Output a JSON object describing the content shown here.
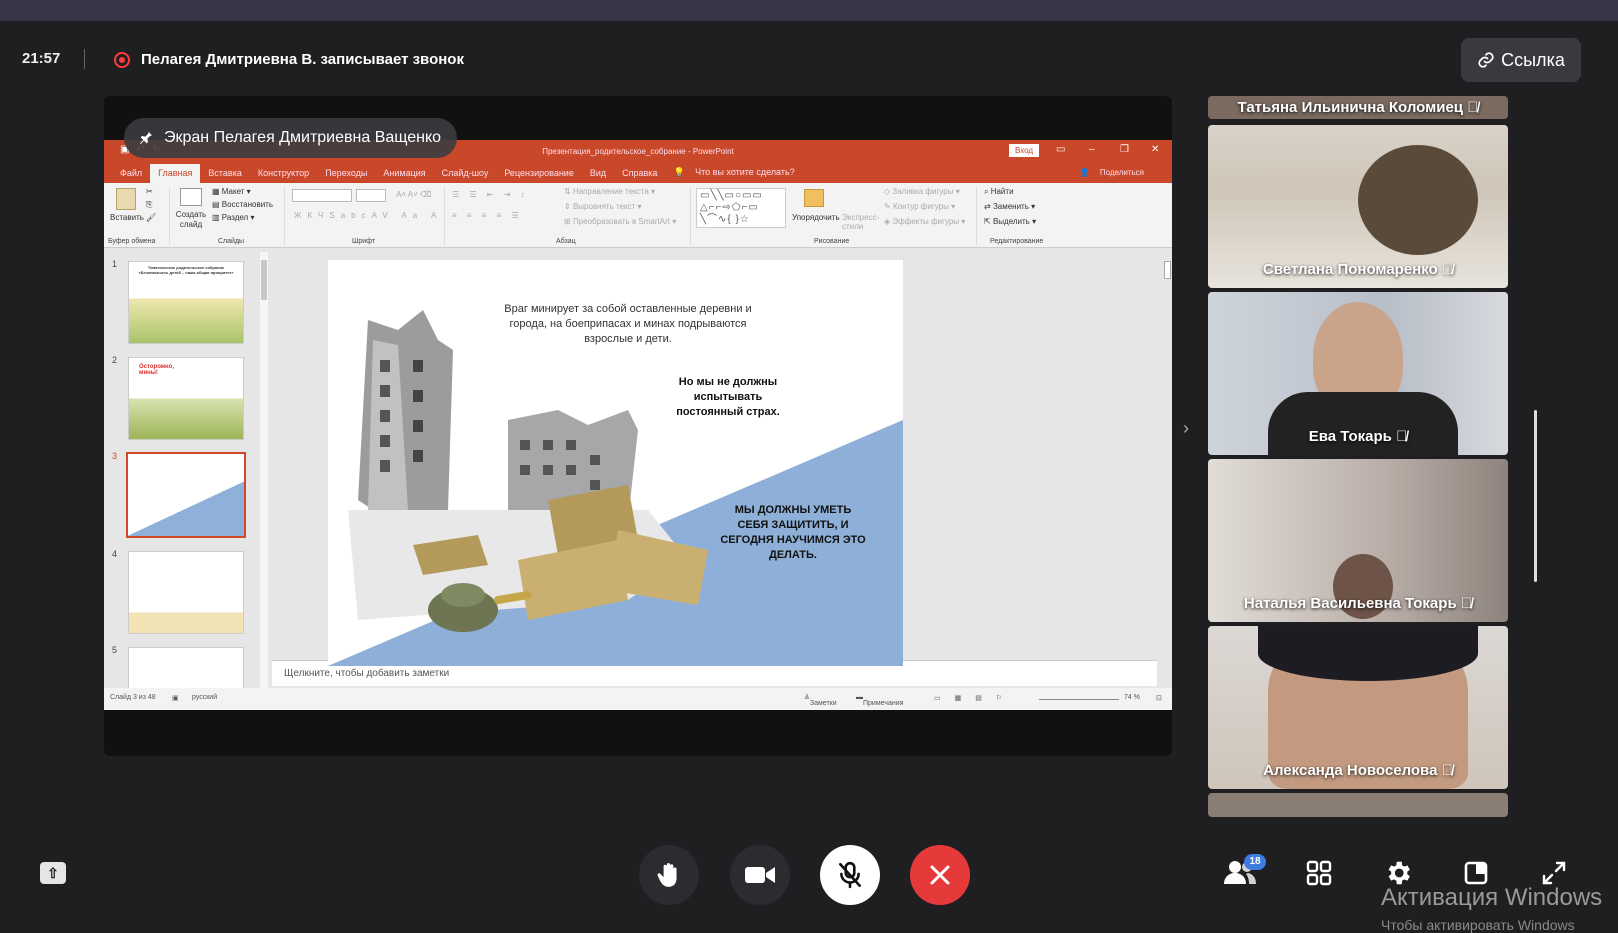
{
  "header": {
    "time": "21:57",
    "recording_text": "Пелагея Дмитриевна В. записывает звонок",
    "link_button": "Ссылка"
  },
  "screen_share": {
    "label": "Экран Пелагея Дмитриевна Ващенко",
    "ppt": {
      "title": "Презентация_родительское_собрание - PowerPoint",
      "signin": "Вход",
      "tabs": [
        "Файл",
        "Главная",
        "Вставка",
        "Конструктор",
        "Переходы",
        "Анимация",
        "Слайд-шоу",
        "Рецензирование",
        "Вид",
        "Справка",
        "Что вы хотите сделать?"
      ],
      "share": "Поделиться",
      "ribbon": {
        "paste": "Вставить",
        "create_slide": "Создать слайд",
        "layout": "Макет",
        "restore": "Восстановить",
        "section": "Раздел",
        "text_direction": "Направление текста",
        "align_text": "Выровнять текст",
        "smartart": "Преобразовать в SmartArt",
        "arrange": "Упорядочить",
        "express_styles": "Экспресс-стили",
        "fill": "Заливка фигуры",
        "outline": "Контур фигуры",
        "effects": "Эффекты фигуры",
        "find": "Найти",
        "replace": "Заменить",
        "select": "Выделить",
        "groups": [
          "Буфер обмена",
          "Слайды",
          "Шрифт",
          "Абзац",
          "Рисование",
          "Редактирование"
        ]
      },
      "thumbs": {
        "numbers": [
          "1",
          "2",
          "3",
          "4",
          "5"
        ],
        "t1_title": "Тематическое родительское собрание «Безопасность детей – наша общая приоритет»",
        "t2_title": "Осторожно, мины!"
      },
      "slide": {
        "text1": "Враг минирует за собой оставленные деревни и города, на боеприпасах и минах подрываются взрослые и дети.",
        "text2": "Но мы не должны испытывать постоянный страх.",
        "text3": "МЫ ДОЛЖНЫ УМЕТЬ СЕБЯ ЗАЩИТИТЬ, И СЕГОДНЯ НАУЧИМСЯ ЭТО ДЕЛАТЬ."
      },
      "notes_placeholder": "Щелкните, чтобы добавить заметки",
      "status": {
        "slide": "Слайд 3 из 48",
        "lang": "русский",
        "notes": "Заметки",
        "comments": "Примечания",
        "zoom": "74 %"
      }
    }
  },
  "participants": [
    {
      "name": "Татьяна Ильинична Коломиец"
    },
    {
      "name": "Светлана Пономаренко"
    },
    {
      "name": "Ева Токарь"
    },
    {
      "name": "Наталья Васильевна Токарь"
    },
    {
      "name": "Александа Новоселова"
    }
  ],
  "controls": {
    "participants_count": "18"
  },
  "watermark": {
    "line1": "Активация Windows",
    "line2": "Чтобы активировать Windows"
  },
  "colors": {
    "ppt_accent": "#c9482a",
    "end_call": "#e5393a",
    "badge": "#3d7be0",
    "record": "#ff3b3b"
  }
}
